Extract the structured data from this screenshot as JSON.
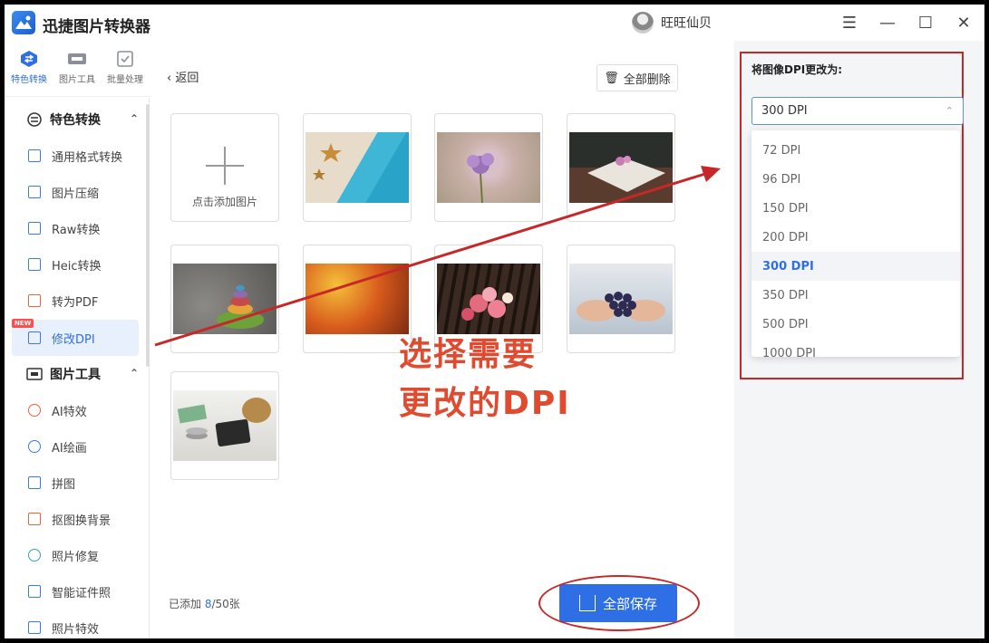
{
  "app": {
    "title": "迅捷图片转换器",
    "user": "旺旺仙贝"
  },
  "window_controls": {
    "menu": "☰",
    "minimize": "—",
    "maximize": "☐",
    "close": "✕"
  },
  "topnav": [
    {
      "label": "特色转换",
      "icon": "swap-icon",
      "active": true
    },
    {
      "label": "图片工具",
      "icon": "image-tool-icon",
      "active": false
    },
    {
      "label": "批量处理",
      "icon": "batch-icon",
      "active": false
    }
  ],
  "sidebar": {
    "group1": {
      "label": "特色转换",
      "chevron": "⌃"
    },
    "group1_items": [
      "通用格式转换",
      "图片压缩",
      "Raw转换",
      "Heic转换",
      "转为PDF",
      "修改DPI"
    ],
    "new_badge": "NEW",
    "group2": {
      "label": "图片工具",
      "chevron": "⌃"
    },
    "group2_items": [
      "AI特效",
      "AI绘画",
      "拼图",
      "抠图换背景",
      "照片修复",
      "智能证件照",
      "照片特效"
    ]
  },
  "main": {
    "back_label": "返回",
    "delete_all_label": "全部删除",
    "add_image_label": "点击添加图片",
    "count_prefix": "已添加 ",
    "count_value": "8",
    "count_suffix": "/50张",
    "save_all_label": "全部保存",
    "images": [
      "beach-starfish-image",
      "purple-flower-image",
      "book-flower-image",
      "stacked-stones-image",
      "autumn-leaves-image",
      "rose-bouquet-image",
      "grapes-hands-image",
      "coins-calculator-image"
    ]
  },
  "annotation": {
    "line1": "选择需要",
    "line2": "更改的DPI",
    "color": "#e04a2f"
  },
  "dpi_panel": {
    "title": "将图像DPI更改为:",
    "selected": "300 DPI",
    "options": [
      "72 DPI",
      "96 DPI",
      "150 DPI",
      "200 DPI",
      "300 DPI",
      "350 DPI",
      "500 DPI",
      "1000 DPI"
    ],
    "selected_index": 4
  },
  "colors": {
    "accent": "#2f6fe6",
    "highlight_red": "#c62828"
  }
}
